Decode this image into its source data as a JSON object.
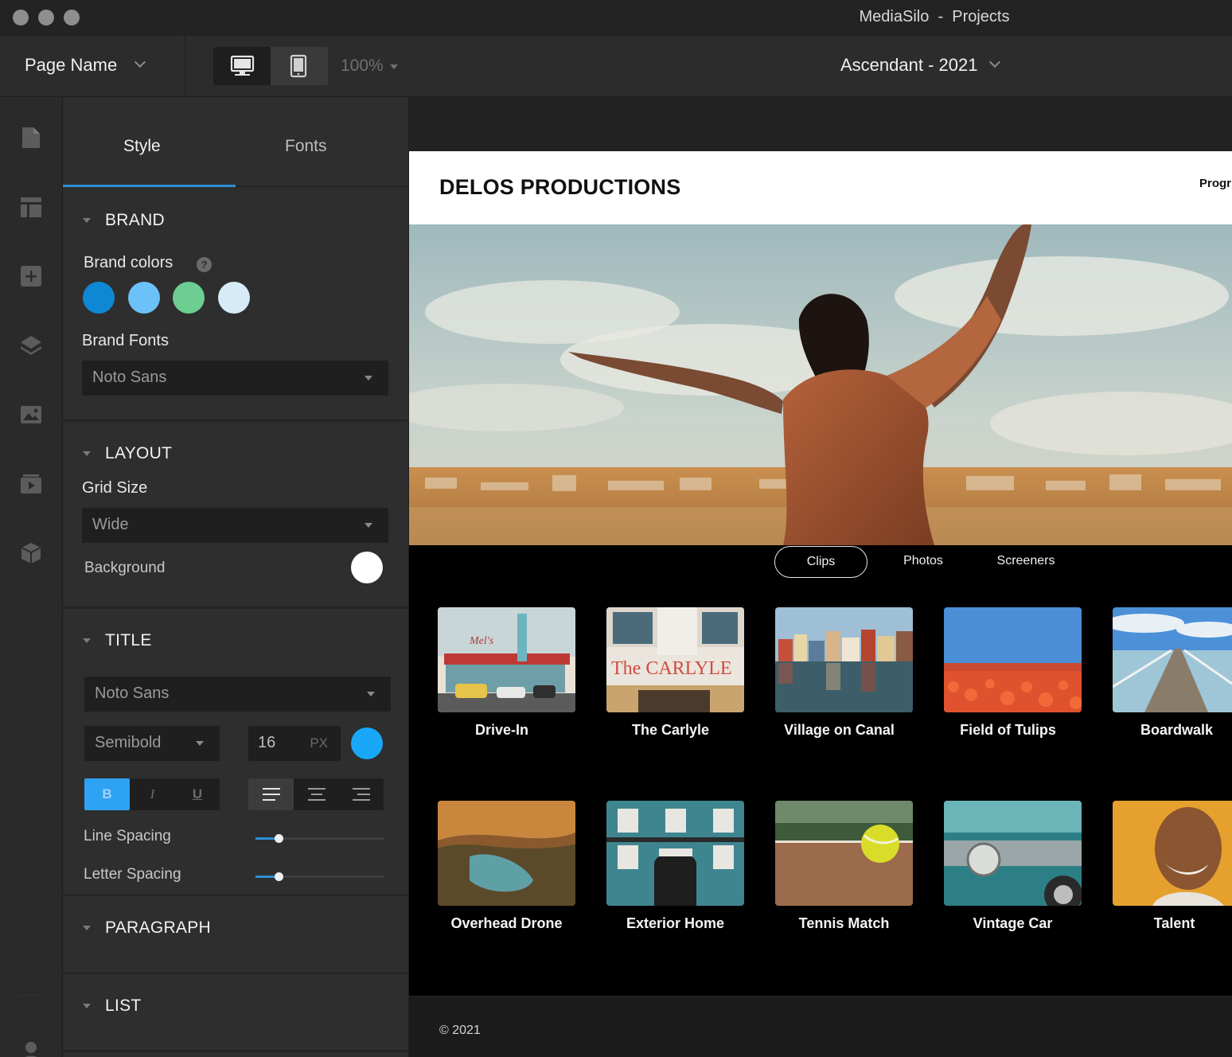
{
  "window": {
    "title": "MediaSilo  -  Projects"
  },
  "toolbar": {
    "page_name": "Page Name",
    "zoom": "100%",
    "project": "Ascendant - 2021"
  },
  "rail": {
    "icons": [
      "pages-icon",
      "layout-icon",
      "add-icon",
      "layers-icon",
      "image-icon",
      "video-icon",
      "package-icon",
      "account-icon"
    ]
  },
  "panel": {
    "tabs": [
      "Style",
      "Fonts"
    ],
    "active_tab": "Style",
    "brand": {
      "heading": "BRAND",
      "colors_label": "Brand colors",
      "colors": [
        "#0e88d4",
        "#6dc1f9",
        "#6cce91",
        "#d7ebf6"
      ],
      "fonts_label": "Brand Fonts",
      "font": "Noto Sans"
    },
    "layout": {
      "heading": "LAYOUT",
      "grid_label": "Grid Size",
      "grid_value": "Wide",
      "background_label": "Background",
      "background_color": "#ffffff"
    },
    "title": {
      "heading": "TITLE",
      "font": "Noto Sans",
      "weight": "Semibold",
      "size": "16",
      "unit": "PX",
      "color": "#19a8f7",
      "style_buttons": [
        "B",
        "I",
        "U"
      ],
      "active_style": "B",
      "active_align": "left",
      "line_spacing_label": "Line Spacing",
      "line_spacing": 0.18,
      "letter_spacing_label": "Letter Spacing",
      "letter_spacing": 0.18
    },
    "paragraph": {
      "heading": "PARAGRAPH"
    },
    "list": {
      "heading": "LIST"
    }
  },
  "site": {
    "title": "DELOS PRODUCTIONS",
    "nav": "Progr",
    "filters": [
      "Clips",
      "Photos",
      "Screeners"
    ],
    "active_filter": "Clips",
    "items": [
      "Drive-In",
      "The Carlyle",
      "Village on Canal",
      "Field of Tulips",
      "Boardwalk",
      "Overhead Drone",
      "Exterior Home",
      "Tennis Match",
      "Vintage Car",
      "Talent"
    ],
    "footer": "© 2021"
  }
}
